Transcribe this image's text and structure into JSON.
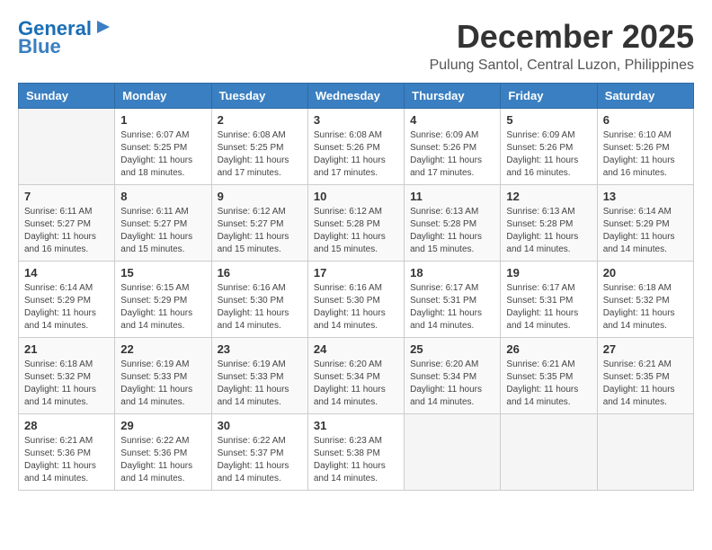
{
  "logo": {
    "line1": "General",
    "line2": "Blue"
  },
  "title": "December 2025",
  "location": "Pulung Santol, Central Luzon, Philippines",
  "headers": [
    "Sunday",
    "Monday",
    "Tuesday",
    "Wednesday",
    "Thursday",
    "Friday",
    "Saturday"
  ],
  "weeks": [
    [
      {
        "day": "",
        "info": ""
      },
      {
        "day": "1",
        "info": "Sunrise: 6:07 AM\nSunset: 5:25 PM\nDaylight: 11 hours\nand 18 minutes."
      },
      {
        "day": "2",
        "info": "Sunrise: 6:08 AM\nSunset: 5:25 PM\nDaylight: 11 hours\nand 17 minutes."
      },
      {
        "day": "3",
        "info": "Sunrise: 6:08 AM\nSunset: 5:26 PM\nDaylight: 11 hours\nand 17 minutes."
      },
      {
        "day": "4",
        "info": "Sunrise: 6:09 AM\nSunset: 5:26 PM\nDaylight: 11 hours\nand 17 minutes."
      },
      {
        "day": "5",
        "info": "Sunrise: 6:09 AM\nSunset: 5:26 PM\nDaylight: 11 hours\nand 16 minutes."
      },
      {
        "day": "6",
        "info": "Sunrise: 6:10 AM\nSunset: 5:26 PM\nDaylight: 11 hours\nand 16 minutes."
      }
    ],
    [
      {
        "day": "7",
        "info": "Sunrise: 6:11 AM\nSunset: 5:27 PM\nDaylight: 11 hours\nand 16 minutes."
      },
      {
        "day": "8",
        "info": "Sunrise: 6:11 AM\nSunset: 5:27 PM\nDaylight: 11 hours\nand 15 minutes."
      },
      {
        "day": "9",
        "info": "Sunrise: 6:12 AM\nSunset: 5:27 PM\nDaylight: 11 hours\nand 15 minutes."
      },
      {
        "day": "10",
        "info": "Sunrise: 6:12 AM\nSunset: 5:28 PM\nDaylight: 11 hours\nand 15 minutes."
      },
      {
        "day": "11",
        "info": "Sunrise: 6:13 AM\nSunset: 5:28 PM\nDaylight: 11 hours\nand 15 minutes."
      },
      {
        "day": "12",
        "info": "Sunrise: 6:13 AM\nSunset: 5:28 PM\nDaylight: 11 hours\nand 14 minutes."
      },
      {
        "day": "13",
        "info": "Sunrise: 6:14 AM\nSunset: 5:29 PM\nDaylight: 11 hours\nand 14 minutes."
      }
    ],
    [
      {
        "day": "14",
        "info": "Sunrise: 6:14 AM\nSunset: 5:29 PM\nDaylight: 11 hours\nand 14 minutes."
      },
      {
        "day": "15",
        "info": "Sunrise: 6:15 AM\nSunset: 5:29 PM\nDaylight: 11 hours\nand 14 minutes."
      },
      {
        "day": "16",
        "info": "Sunrise: 6:16 AM\nSunset: 5:30 PM\nDaylight: 11 hours\nand 14 minutes."
      },
      {
        "day": "17",
        "info": "Sunrise: 6:16 AM\nSunset: 5:30 PM\nDaylight: 11 hours\nand 14 minutes."
      },
      {
        "day": "18",
        "info": "Sunrise: 6:17 AM\nSunset: 5:31 PM\nDaylight: 11 hours\nand 14 minutes."
      },
      {
        "day": "19",
        "info": "Sunrise: 6:17 AM\nSunset: 5:31 PM\nDaylight: 11 hours\nand 14 minutes."
      },
      {
        "day": "20",
        "info": "Sunrise: 6:18 AM\nSunset: 5:32 PM\nDaylight: 11 hours\nand 14 minutes."
      }
    ],
    [
      {
        "day": "21",
        "info": "Sunrise: 6:18 AM\nSunset: 5:32 PM\nDaylight: 11 hours\nand 14 minutes."
      },
      {
        "day": "22",
        "info": "Sunrise: 6:19 AM\nSunset: 5:33 PM\nDaylight: 11 hours\nand 14 minutes."
      },
      {
        "day": "23",
        "info": "Sunrise: 6:19 AM\nSunset: 5:33 PM\nDaylight: 11 hours\nand 14 minutes."
      },
      {
        "day": "24",
        "info": "Sunrise: 6:20 AM\nSunset: 5:34 PM\nDaylight: 11 hours\nand 14 minutes."
      },
      {
        "day": "25",
        "info": "Sunrise: 6:20 AM\nSunset: 5:34 PM\nDaylight: 11 hours\nand 14 minutes."
      },
      {
        "day": "26",
        "info": "Sunrise: 6:21 AM\nSunset: 5:35 PM\nDaylight: 11 hours\nand 14 minutes."
      },
      {
        "day": "27",
        "info": "Sunrise: 6:21 AM\nSunset: 5:35 PM\nDaylight: 11 hours\nand 14 minutes."
      }
    ],
    [
      {
        "day": "28",
        "info": "Sunrise: 6:21 AM\nSunset: 5:36 PM\nDaylight: 11 hours\nand 14 minutes."
      },
      {
        "day": "29",
        "info": "Sunrise: 6:22 AM\nSunset: 5:36 PM\nDaylight: 11 hours\nand 14 minutes."
      },
      {
        "day": "30",
        "info": "Sunrise: 6:22 AM\nSunset: 5:37 PM\nDaylight: 11 hours\nand 14 minutes."
      },
      {
        "day": "31",
        "info": "Sunrise: 6:23 AM\nSunset: 5:38 PM\nDaylight: 11 hours\nand 14 minutes."
      },
      {
        "day": "",
        "info": ""
      },
      {
        "day": "",
        "info": ""
      },
      {
        "day": "",
        "info": ""
      }
    ]
  ]
}
